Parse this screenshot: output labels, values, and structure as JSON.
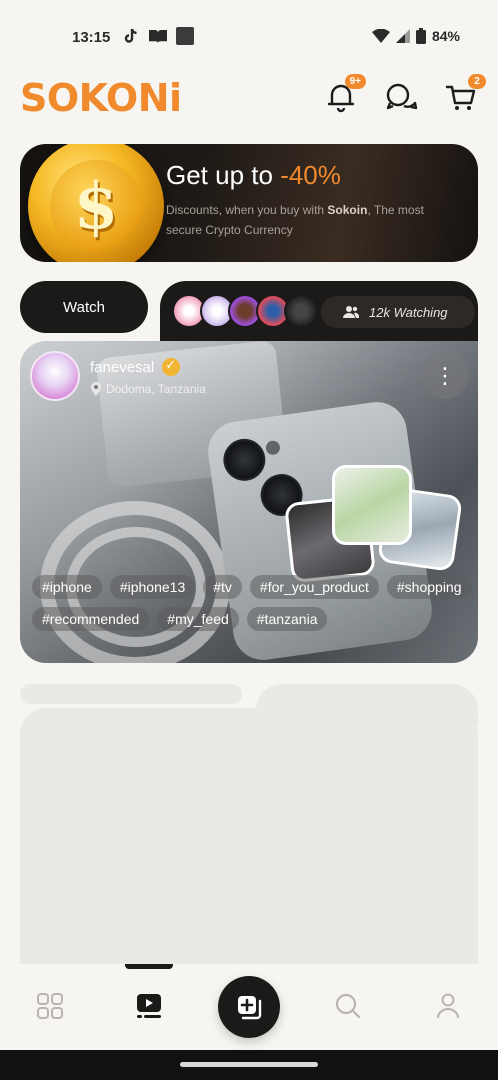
{
  "status_bar": {
    "time": "13:15",
    "battery": "84%"
  },
  "header": {
    "logo": "SOKONi",
    "notifications_badge": "9+",
    "cart_badge": "2"
  },
  "promo": {
    "title_prefix": "Get up to ",
    "title_discount": "-40%",
    "subtitle_before": "Discounts, when you buy with ",
    "subtitle_brand": "Sokoin",
    "subtitle_after": ", The most secure Crypto Currency"
  },
  "live": {
    "watch_label": "Watch",
    "watching_count": "12k Watching",
    "username": "fanevesal",
    "location": "Dodoma, Tanzania",
    "tags": [
      "#iphone",
      "#iphone13",
      "#tv",
      "#for_you_product",
      "#shopping",
      "#recommended",
      "#my_feed",
      "#tanzania"
    ]
  },
  "colors": {
    "accent": "#f08a2c",
    "dark": "#1c1a18",
    "background": "#f6f5f1"
  },
  "bottom_nav": {
    "items": [
      "grid-icon",
      "video-feed-icon",
      "add-post-icon",
      "search-icon",
      "profile-icon"
    ],
    "active": "video-feed-icon"
  }
}
